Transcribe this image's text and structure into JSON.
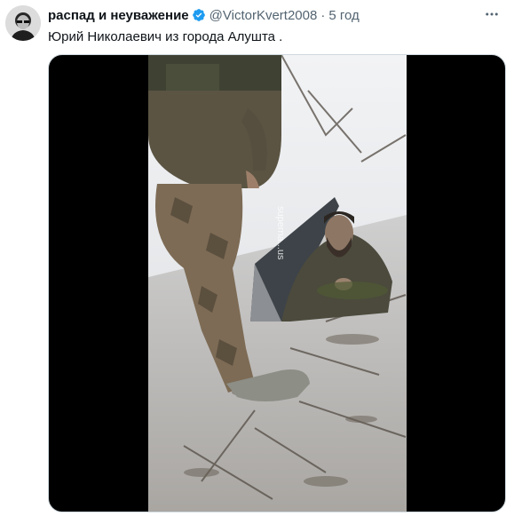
{
  "tweet": {
    "display_name": "распад и неуважение",
    "handle": "@VictorKvert2008",
    "separator": "·",
    "time": "5 год",
    "text": "Юрий Николаевич из города Алушта .",
    "more_icon": "more-horizontal-icon",
    "verified_icon": "verified-badge-icon"
  },
  "media": {
    "type": "video",
    "watermark": "superna...us"
  },
  "colors": {
    "accent": "#1d9bf0",
    "secondary_text": "#536471",
    "primary_text": "#0f1419"
  }
}
